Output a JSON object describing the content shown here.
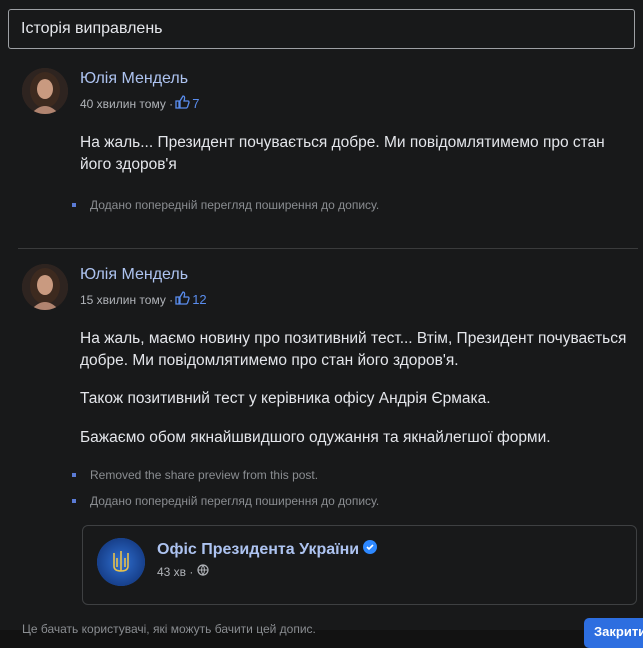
{
  "dialog": {
    "title": "Історія виправлень"
  },
  "revisions": [
    {
      "author": "Юлія Мендель",
      "time": "40 хвилин тому ·",
      "likes": "7",
      "paragraphs": [
        "На жаль... Президент почувається добре. Ми повідомлятимемо про стан його здоров'я"
      ],
      "changes": [
        "Додано попередній перегляд поширення до допису."
      ]
    },
    {
      "author": "Юлія Мендель",
      "time": "15 хвилин тому ·",
      "likes": "12",
      "paragraphs": [
        "На жаль, маємо новину про позитивний тест... Втім, Президент почувається добре. Ми повідомлятимемо про стан його здоров'я.",
        "Також позитивний тест у керівника офісу Андрія Єрмака.",
        "Бажаємо обом якнайшвидшого одужання та якнайлегшої форми."
      ],
      "changes": [
        "Removed the share preview from this post.",
        "Додано попередній перегляд поширення до допису."
      ]
    }
  ],
  "shared_card": {
    "page_name": "Офіс Президента України",
    "time": "43 хв ·"
  },
  "footer": {
    "note": "Це бачать користувачі, які можуть бачити цей допис.",
    "close_label": "Закрити"
  },
  "colors": {
    "link": "#adc3f0",
    "like": "#5a8dee",
    "bullet": "#5b7bd5",
    "verified": "#2d88ff"
  },
  "icons": [
    "like-icon",
    "verified-badge-icon",
    "globe-icon",
    "trident-icon"
  ]
}
